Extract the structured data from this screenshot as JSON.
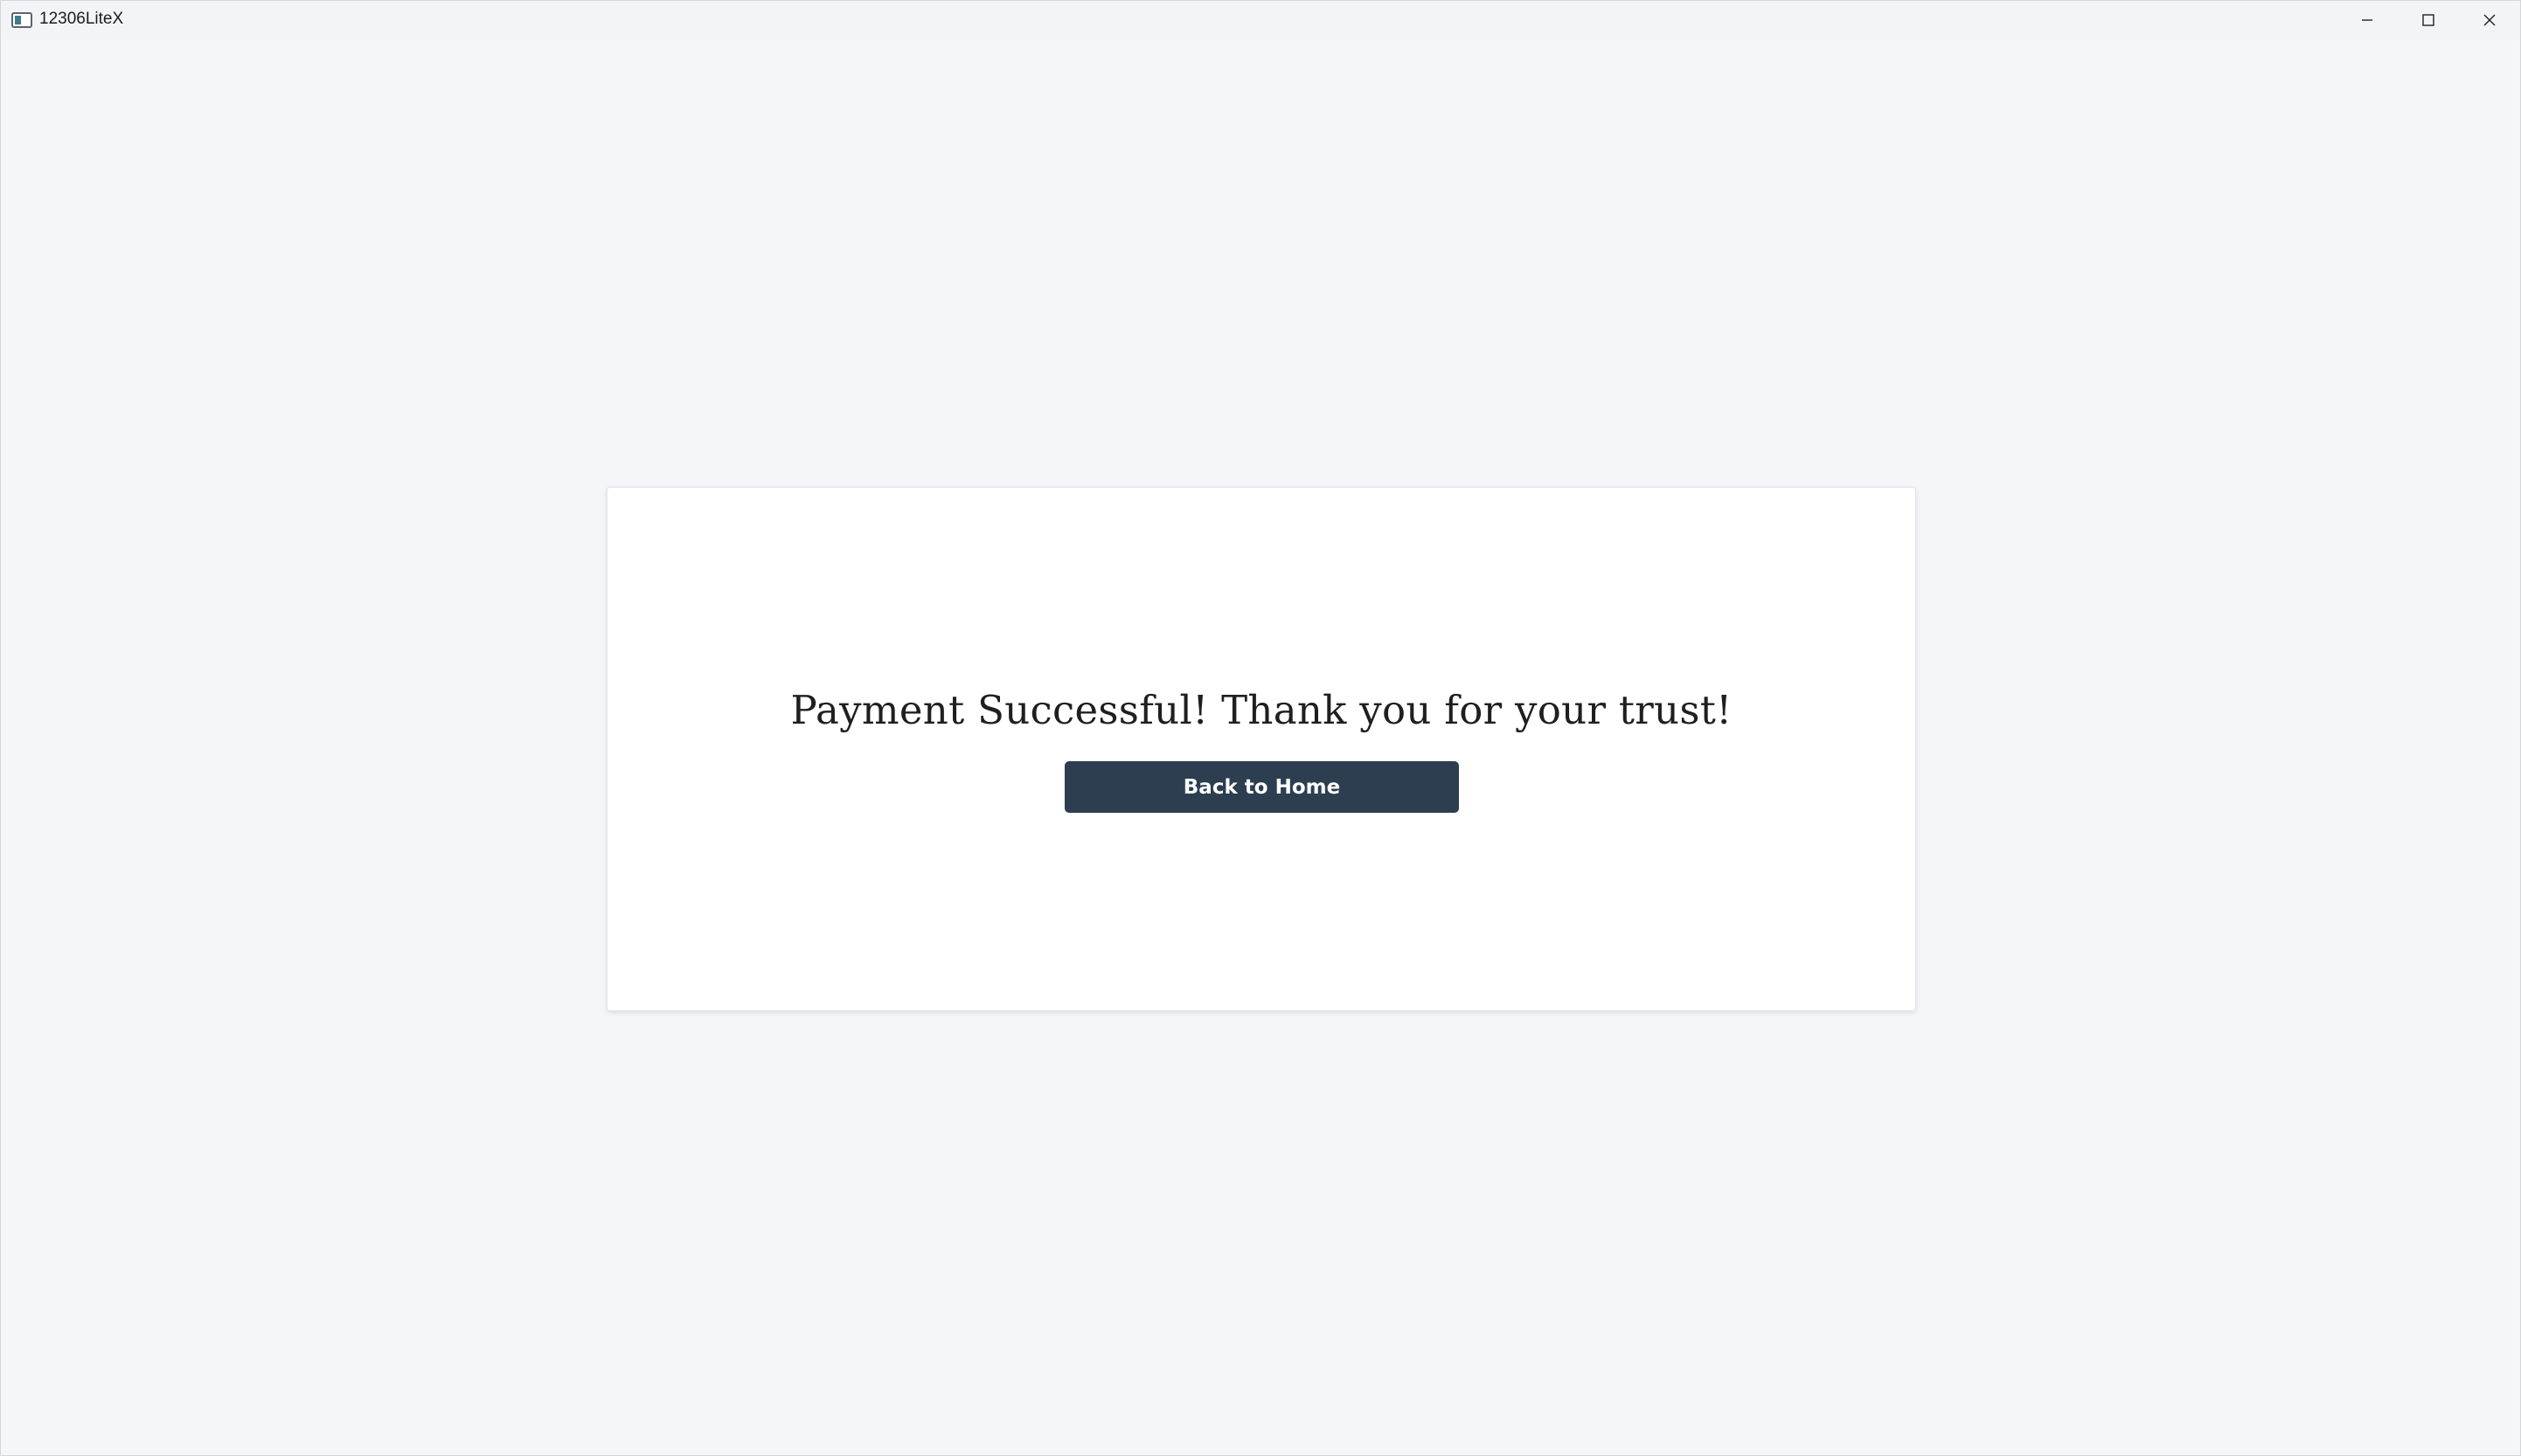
{
  "window": {
    "title": "12306LiteX",
    "controls": {
      "minimize_icon": "minimize-icon",
      "maximize_icon": "maximize-icon",
      "close_icon": "close-icon"
    }
  },
  "main": {
    "message": "Payment Successful! Thank you for your trust!",
    "back_button_label": "Back to Home"
  },
  "colors": {
    "background": "#f5f6f9",
    "card": "#ffffff",
    "button": "#2c3e50",
    "button_text": "#ffffff",
    "text": "#1f1f1f"
  }
}
